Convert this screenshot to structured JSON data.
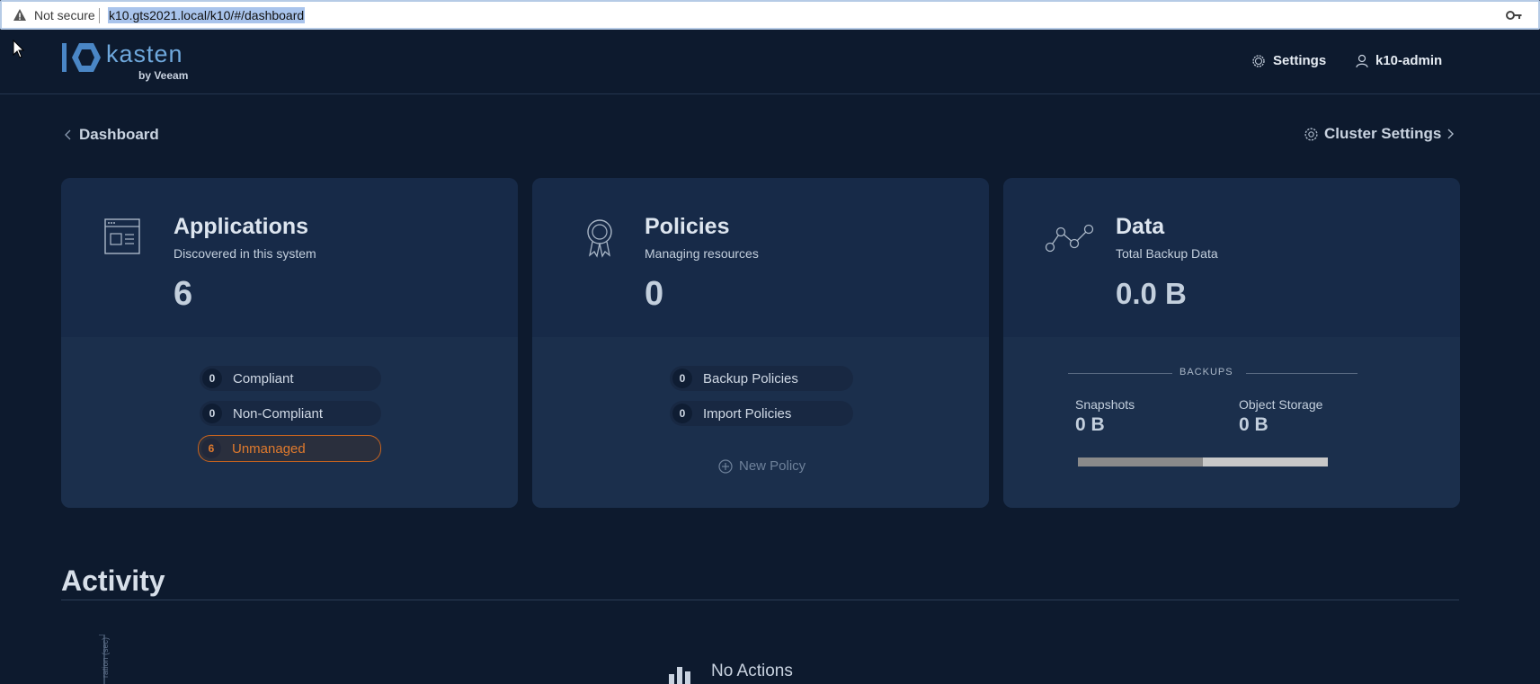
{
  "browser": {
    "security_text": "Not secure",
    "url": "k10.gts2021.local/k10/#/dashboard"
  },
  "header": {
    "logo_word": "kasten",
    "logo_sub": "by Veeam",
    "settings_label": "Settings",
    "user_label": "k10-admin"
  },
  "breadcrumb": {
    "label": "Dashboard"
  },
  "cluster_settings": {
    "label": "Cluster Settings"
  },
  "cards": {
    "applications": {
      "title": "Applications",
      "subtitle": "Discovered in this system",
      "count": "6",
      "items": [
        {
          "count": "0",
          "label": "Compliant"
        },
        {
          "count": "0",
          "label": "Non-Compliant"
        },
        {
          "count": "6",
          "label": "Unmanaged"
        }
      ]
    },
    "policies": {
      "title": "Policies",
      "subtitle": "Managing resources",
      "count": "0",
      "items": [
        {
          "count": "0",
          "label": "Backup Policies"
        },
        {
          "count": "0",
          "label": "Import Policies"
        }
      ],
      "new_policy_label": "New Policy"
    },
    "data": {
      "title": "Data",
      "subtitle": "Total Backup Data",
      "total": "0.0 B",
      "backups_label": "BACKUPS",
      "snapshots_label": "Snapshots",
      "snapshots_value": "0 B",
      "object_storage_label": "Object Storage",
      "object_storage_value": "0 B",
      "storage_split_fraction": 0.5
    }
  },
  "activity": {
    "title": "Activity",
    "axis_label": "ration (sec)",
    "empty_text": "No Actions"
  },
  "colors": {
    "background": "#0d1a2e",
    "card": "#1a2c47",
    "accent_orange": "#e07a2d",
    "logo_blue": "#6fa8dc"
  }
}
